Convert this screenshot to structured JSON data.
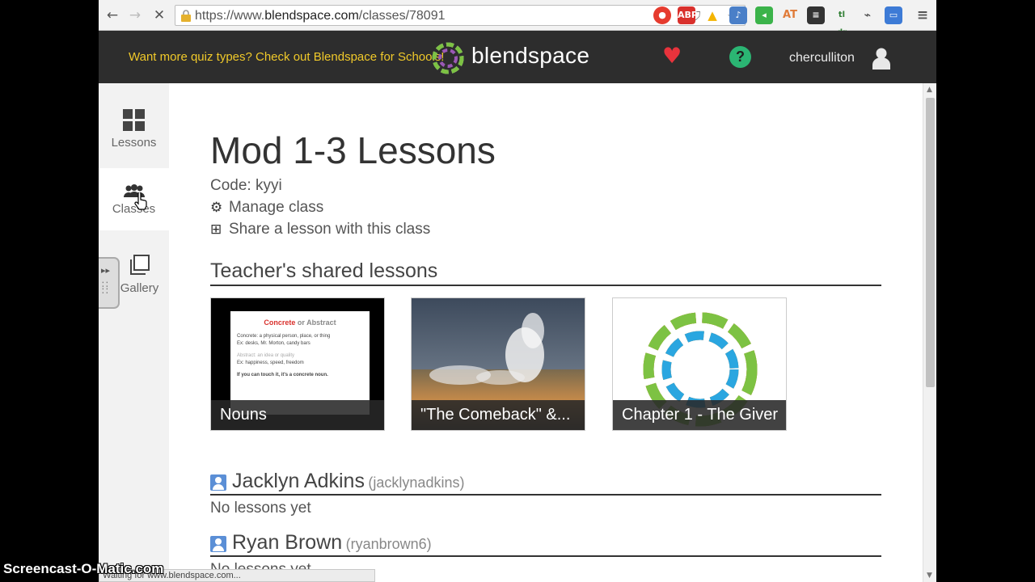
{
  "browser": {
    "url_prefix": "https://www.",
    "url_host": "blendspace.com",
    "url_path": "/classes/78091",
    "status_text": "Waiting for www.blendspace.com...",
    "extensions": [
      {
        "name": "adblock-icon",
        "label": "ABP",
        "color": "#d9302c"
      },
      {
        "name": "drive-icon",
        "label": "▲",
        "color": "#f4b400"
      },
      {
        "name": "at-icon",
        "label": "AT",
        "color": "#e07b39"
      },
      {
        "name": "tldr-icon",
        "label": "tl dr",
        "color": "#2e7d32"
      }
    ]
  },
  "header": {
    "promo": "Want more quiz types? Check out Blendspace for Schools!",
    "logo_text": "blendspace",
    "username": "cherculliton"
  },
  "sidebar": {
    "items": [
      {
        "label": "Lessons"
      },
      {
        "label": "Classes"
      },
      {
        "label": "Gallery"
      }
    ]
  },
  "main": {
    "title": "Mod 1-3 Lessons",
    "code": "Code: kyyi",
    "manage": "Manage class",
    "share": "Share a lesson with this class",
    "shared_heading": "Teacher's shared lessons",
    "lessons": [
      {
        "title": "Nouns",
        "slide": {
          "heading_red": "Concrete",
          "heading_or": " or ",
          "heading_rest": "Abstract",
          "line1": "Concrete: a physical person, place, or thing",
          "line2": "Ex: desks, Mr. Morton, candy bars",
          "line3": "Abstract: an idea or quality",
          "line4": "Ex: happiness, speed, freedom",
          "line5": "If you can touch it, it's a concrete noun."
        }
      },
      {
        "title": "\"The Comeback\" &..."
      },
      {
        "title": "Chapter 1 - The Giver"
      }
    ],
    "students": [
      {
        "name": "Jacklyn Adkins",
        "username": "(jacklynadkins)",
        "status": "No lessons yet"
      },
      {
        "name": "Ryan Brown",
        "username": "(ryanbrown6)",
        "status": "No lessons yet"
      }
    ]
  },
  "watermark": "Screencast-O-Matic.com",
  "colors": {
    "header_bg": "#2d2d2d",
    "promo": "#f0c92a",
    "heart": "#e8333c",
    "help": "#2bb573"
  }
}
